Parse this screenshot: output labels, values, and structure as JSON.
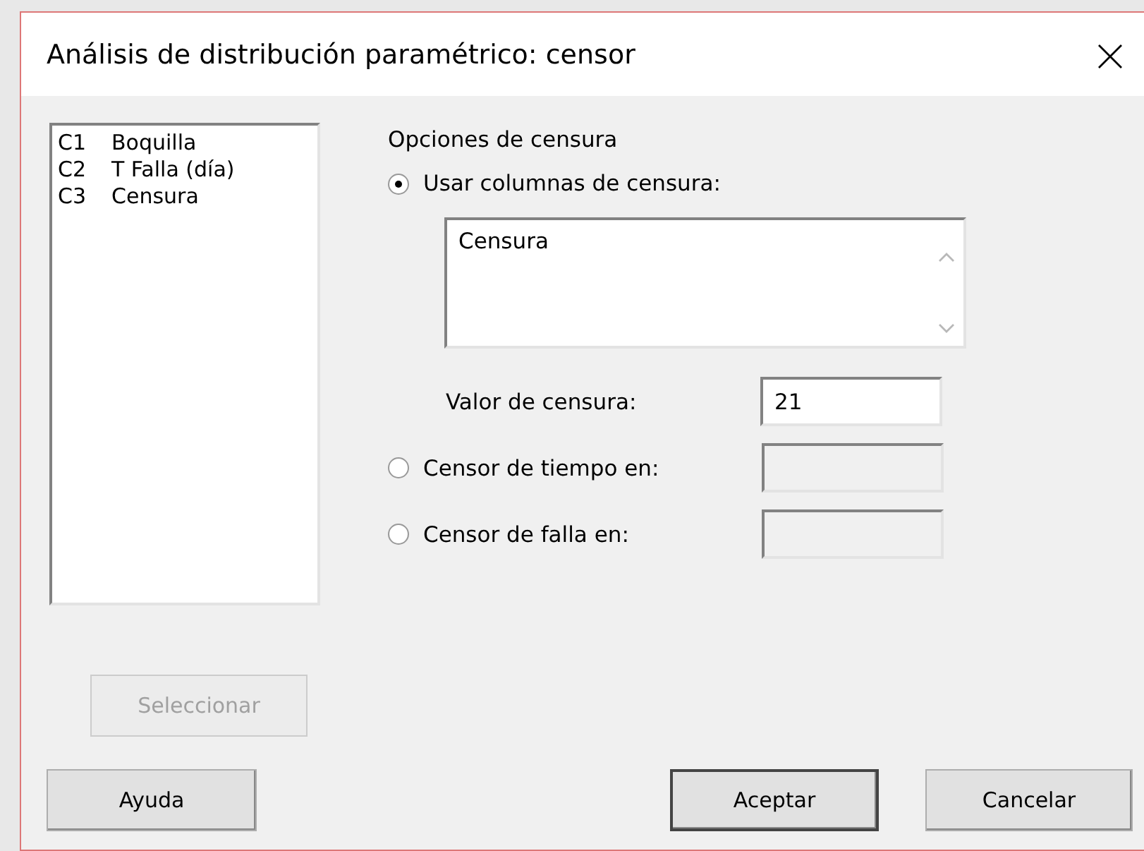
{
  "window": {
    "title": "Análisis de distribución paramétrico: censor"
  },
  "variables": [
    {
      "column": "C1",
      "name": "Boquilla"
    },
    {
      "column": "C2",
      "name": "T Falla (día)"
    },
    {
      "column": "C3",
      "name": "Censura"
    }
  ],
  "censoring": {
    "heading": "Opciones de censura",
    "options": [
      {
        "label": "Usar columnas de censura:",
        "selected": true
      },
      {
        "label": "Censor de tiempo en:",
        "selected": false
      },
      {
        "label": "Censor de falla en:",
        "selected": false
      }
    ],
    "columns_value": "Censura",
    "censor_value": {
      "label": "Valor de censura:",
      "value": "21"
    }
  },
  "select_button": {
    "label": "Seleccionar",
    "disabled": true
  },
  "buttons": [
    {
      "label": "Ayuda",
      "kind": "help"
    },
    {
      "label": "Aceptar",
      "kind": "default"
    },
    {
      "label": "Cancelar",
      "kind": "cancel"
    }
  ]
}
